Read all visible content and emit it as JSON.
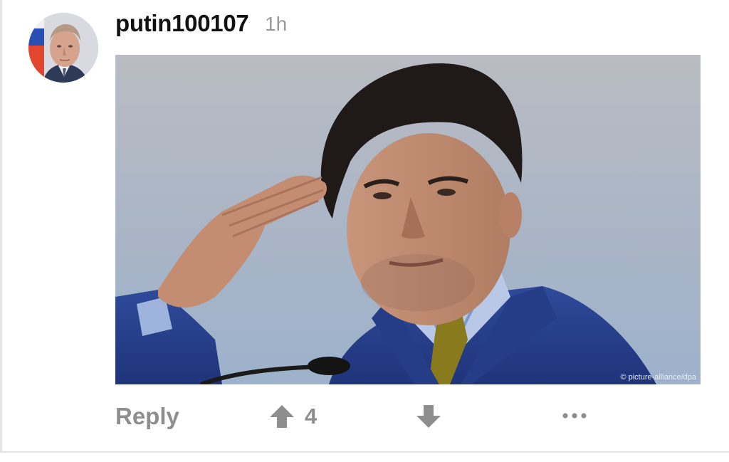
{
  "comment": {
    "username": "putin100107",
    "timestamp": "1h",
    "photo_credit": "© picture-alliance/dpa",
    "actions": {
      "reply_label": "Reply",
      "vote_count": "4"
    }
  },
  "icons": {
    "upvote": "arrow-up-icon",
    "downvote": "arrow-down-icon",
    "more": "more-horizontal-icon"
  },
  "colors": {
    "username": "#111111",
    "meta_gray": "#9a9a9a",
    "action_gray": "#8e8e8e",
    "divider": "#e3e3e3"
  }
}
